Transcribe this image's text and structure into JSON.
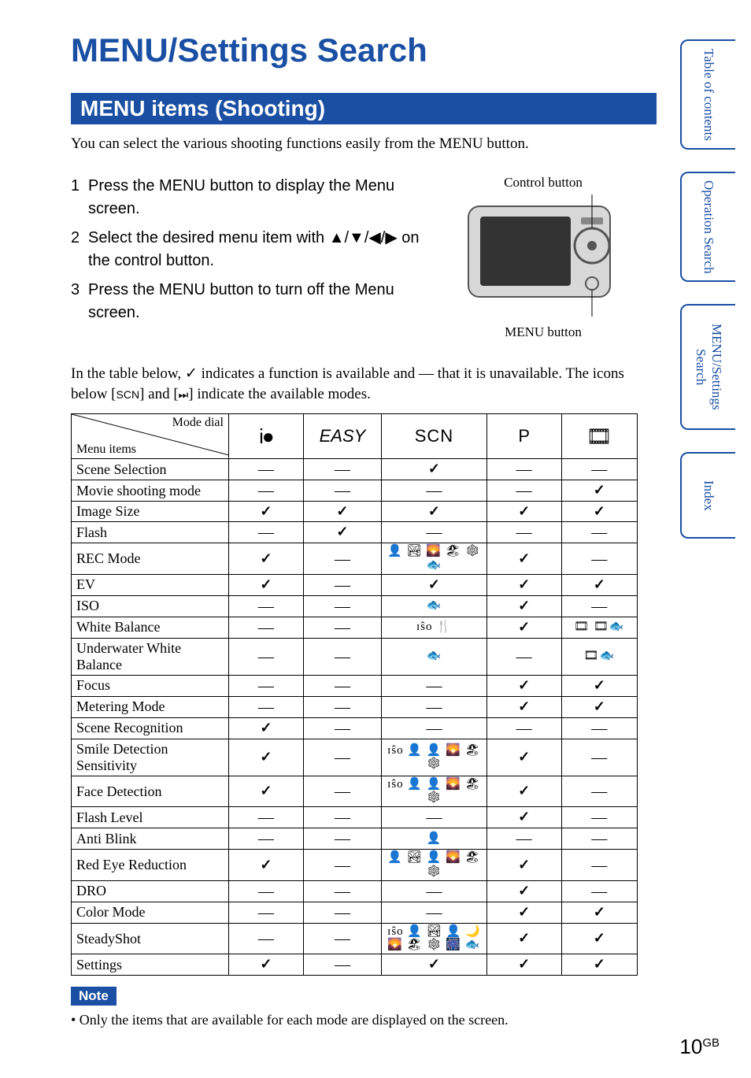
{
  "title": "MENU/Settings Search",
  "section_heading": "MENU items (Shooting)",
  "intro": "You can select the various shooting functions easily from the MENU button.",
  "steps": [
    "Press the MENU button to display the Menu screen.",
    "Select the desired menu item with ▲/▼/◀/▶ on the control button.",
    "Press the MENU button to turn off the Menu screen."
  ],
  "diagram": {
    "control_button": "Control button",
    "menu_button": "MENU button"
  },
  "table_intro_1": "In the table below, ✓ indicates a function is available and — that it is unavailable. The icons below [",
  "table_intro_scn": "SCN",
  "table_intro_2": "] and [",
  "table_intro_film": "⏭",
  "table_intro_3": "] indicate the available modes.",
  "header": {
    "diag_top": "Mode dial",
    "diag_bottom": "Menu items",
    "cols": {
      "auto_icon": "i●",
      "easy": "EASY",
      "scn": "SCN",
      "p": "P",
      "film_icon": "🎞"
    }
  },
  "rows": [
    {
      "label": "Scene Selection",
      "c": [
        "—",
        "—",
        "✓",
        "—",
        "—"
      ]
    },
    {
      "label": "Movie shooting mode",
      "c": [
        "—",
        "—",
        "—",
        "—",
        "✓"
      ]
    },
    {
      "label": "Image Size",
      "c": [
        "✓",
        "✓",
        "✓",
        "✓",
        "✓"
      ]
    },
    {
      "label": "Flash",
      "c": [
        "—",
        "✓",
        "—",
        "—",
        "—"
      ]
    },
    {
      "label": "REC Mode",
      "c": [
        "✓",
        "—",
        "icons:👤 🏞 🌄 🏖 ❄ 🐟",
        "✓",
        "—"
      ]
    },
    {
      "label": "EV",
      "c": [
        "✓",
        "—",
        "✓",
        "✓",
        "✓"
      ]
    },
    {
      "label": "ISO",
      "c": [
        "—",
        "—",
        "icons:🐟",
        "✓",
        "—"
      ]
    },
    {
      "label": "White Balance",
      "c": [
        "—",
        "—",
        "icons:ɪŝo 🍴",
        "✓",
        "icons:🎞 🎞🐟"
      ]
    },
    {
      "label": "Underwater White Balance",
      "c": [
        "—",
        "—",
        "icons:🐟",
        "—",
        "icons:🎞🐟"
      ]
    },
    {
      "label": "Focus",
      "c": [
        "—",
        "—",
        "—",
        "✓",
        "✓"
      ]
    },
    {
      "label": "Metering Mode",
      "c": [
        "—",
        "—",
        "—",
        "✓",
        "✓"
      ]
    },
    {
      "label": "Scene Recognition",
      "c": [
        "✓",
        "—",
        "—",
        "—",
        "—"
      ]
    },
    {
      "label": "Smile Detection Sensitivity",
      "c": [
        "✓",
        "—",
        "icons:ɪŝo 👤 👤 🌄 🏖 ❄",
        "✓",
        "—"
      ]
    },
    {
      "label": "Face Detection",
      "c": [
        "✓",
        "—",
        "icons:ɪŝo 👤 👤 🌄 🏖 ❄",
        "✓",
        "—"
      ]
    },
    {
      "label": "Flash Level",
      "c": [
        "—",
        "—",
        "—",
        "✓",
        "—"
      ]
    },
    {
      "label": "Anti Blink",
      "c": [
        "—",
        "—",
        "icons:👤",
        "—",
        "—"
      ]
    },
    {
      "label": "Red Eye Reduction",
      "c": [
        "✓",
        "—",
        "icons:👤 🏞 👤 🌄 🏖 ❄",
        "✓",
        "—"
      ]
    },
    {
      "label": "DRO",
      "c": [
        "—",
        "—",
        "—",
        "✓",
        "—"
      ]
    },
    {
      "label": "Color Mode",
      "c": [
        "—",
        "—",
        "—",
        "✓",
        "✓"
      ]
    },
    {
      "label": "SteadyShot",
      "c": [
        "—",
        "—",
        "icons:ɪŝo 👤 🏞 👤 🌙 🌄 🏖 ❄ 🎆 🐟",
        "✓",
        "✓"
      ]
    },
    {
      "label": "Settings",
      "c": [
        "✓",
        "—",
        "✓",
        "✓",
        "✓"
      ]
    }
  ],
  "note_badge": "Note",
  "note_text": "• Only the items that are available for each mode are displayed on the screen.",
  "side_tabs": [
    "Table of contents",
    "Operation Search",
    "MENU/Settings Search",
    "Index"
  ],
  "page_number": "10",
  "page_number_suffix": "GB"
}
